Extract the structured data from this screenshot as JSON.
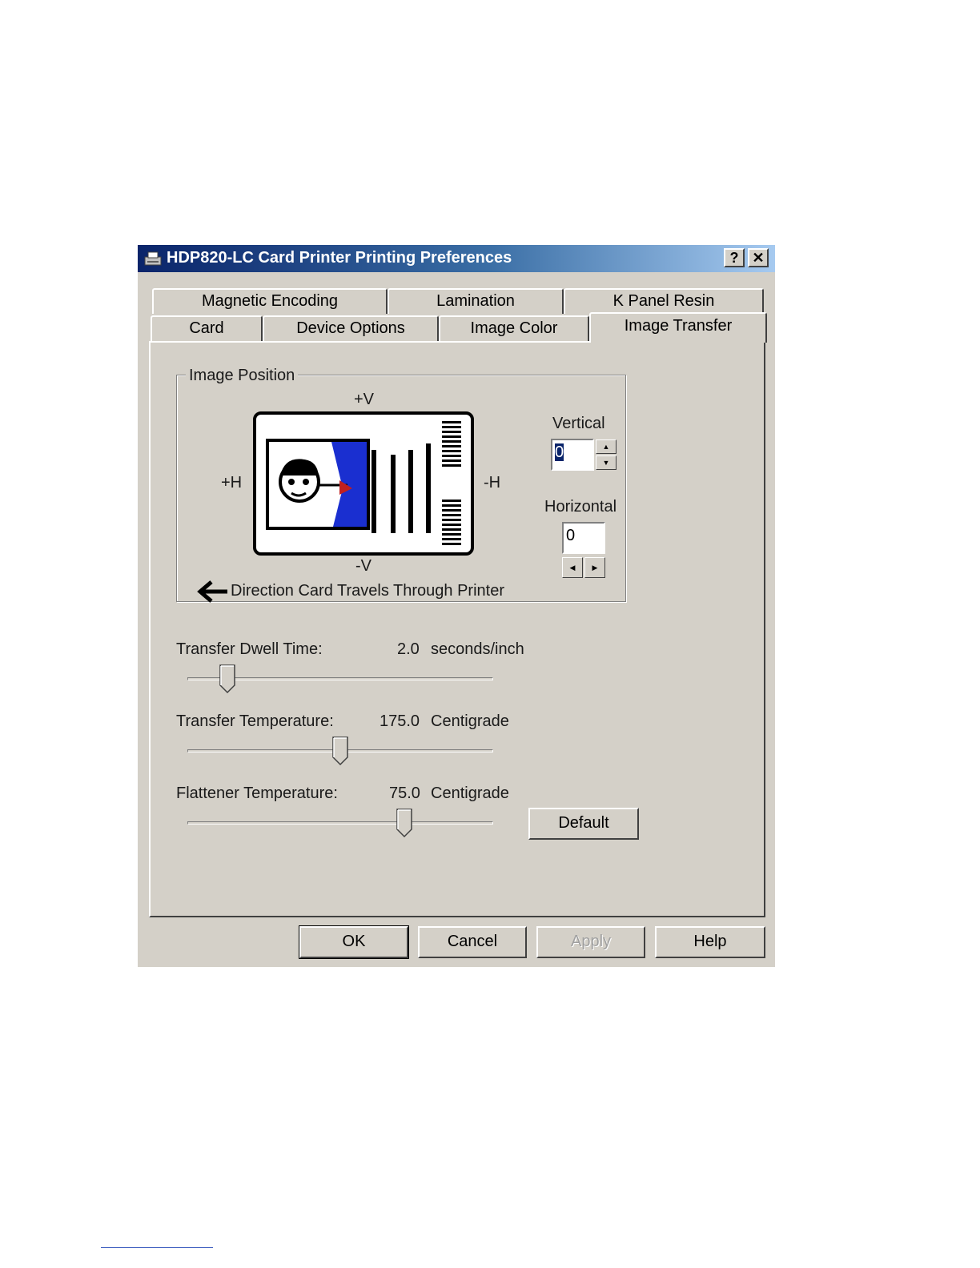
{
  "window": {
    "title": "HDP820-LC Card Printer Printing Preferences",
    "help_button": "?",
    "close_button": "✕"
  },
  "tabs": {
    "row1": [
      "Magnetic Encoding",
      "Lamination",
      "K Panel Resin"
    ],
    "row2": [
      "Card",
      "Device Options",
      "Image Color",
      "Image Transfer"
    ],
    "active": "Image Transfer"
  },
  "image_position": {
    "group_label": "Image Position",
    "plus_v": "+V",
    "minus_v": "-V",
    "plus_h": "+H",
    "minus_h": "-H",
    "direction_text": "Direction Card Travels Through Printer",
    "vertical_label": "Vertical",
    "vertical_value": "0",
    "horizontal_label": "Horizontal",
    "horizontal_value": "0"
  },
  "sliders": {
    "dwell": {
      "label": "Transfer Dwell Time:",
      "value": "2.0",
      "unit": "seconds/inch",
      "position": 0.13
    },
    "transfer_temp": {
      "label": "Transfer Temperature:",
      "value": "175.0",
      "unit": "Centigrade",
      "position": 0.5
    },
    "flattener_temp": {
      "label": "Flattener Temperature:",
      "value": "75.0",
      "unit": "Centigrade",
      "position": 0.71
    }
  },
  "buttons": {
    "default": "Default",
    "ok": "OK",
    "cancel": "Cancel",
    "apply": "Apply",
    "help": "Help"
  }
}
